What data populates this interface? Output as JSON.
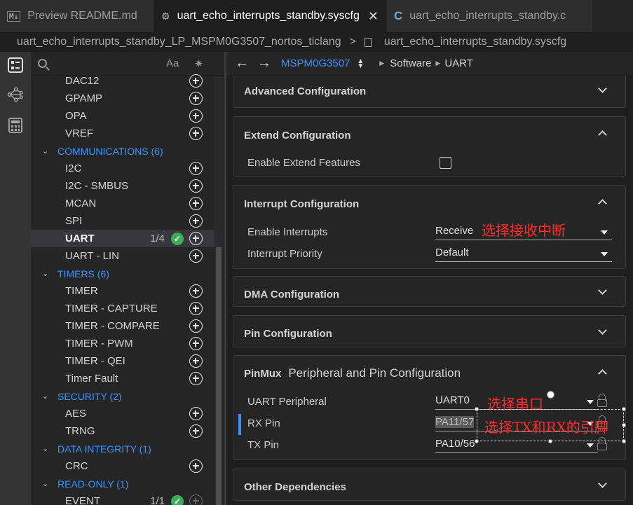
{
  "tabs": [
    {
      "icon": "markdown-icon",
      "icon_text": "M↓",
      "label": "Preview README.md",
      "active": false
    },
    {
      "icon": "gear-icon",
      "icon_text": "⚙",
      "label": "uart_echo_interrupts_standby.syscfg",
      "active": true,
      "close": "✕"
    },
    {
      "icon": "c-file-icon",
      "icon_text": "C",
      "label": "uart_echo_interrupts_standby.c",
      "active": false
    }
  ],
  "breadcrumb": {
    "folder": "uart_echo_interrupts_standby_LP_MSPM0G3507_nortos_ticlang",
    "separator": ">",
    "file": "uart_echo_interrupts_standby.syscfg"
  },
  "search": {
    "aa": "Aa",
    "regex": "✷"
  },
  "sidebar_rows": [
    {
      "type": "item",
      "label": "DAC12",
      "plus": true
    },
    {
      "type": "item",
      "label": "GPAMP",
      "plus": true
    },
    {
      "type": "item",
      "label": "OPA",
      "plus": true
    },
    {
      "type": "item",
      "label": "VREF",
      "plus": true
    },
    {
      "type": "cat",
      "label": "COMMUNICATIONS (6)"
    },
    {
      "type": "item",
      "label": "I2C",
      "plus": true
    },
    {
      "type": "item",
      "label": "I2C - SMBUS",
      "plus": true
    },
    {
      "type": "item",
      "label": "MCAN",
      "plus": true
    },
    {
      "type": "item",
      "label": "SPI",
      "plus": true
    },
    {
      "type": "item",
      "label": "UART",
      "count": "1/4",
      "check": true,
      "plus": true,
      "selected": true
    },
    {
      "type": "item",
      "label": "UART - LIN",
      "plus": true
    },
    {
      "type": "cat",
      "label": "TIMERS (6)"
    },
    {
      "type": "item",
      "label": "TIMER",
      "plus": true
    },
    {
      "type": "item",
      "label": "TIMER - CAPTURE",
      "plus": true
    },
    {
      "type": "item",
      "label": "TIMER - COMPARE",
      "plus": true
    },
    {
      "type": "item",
      "label": "TIMER - PWM",
      "plus": true
    },
    {
      "type": "item",
      "label": "TIMER - QEI",
      "plus": true
    },
    {
      "type": "item",
      "label": "Timer Fault",
      "plus": true
    },
    {
      "type": "cat",
      "label": "SECURITY (2)"
    },
    {
      "type": "item",
      "label": "AES",
      "plus": true
    },
    {
      "type": "item",
      "label": "TRNG",
      "plus": true
    },
    {
      "type": "cat",
      "label": "DATA INTEGRITY (1)"
    },
    {
      "type": "item",
      "label": "CRC",
      "plus": true
    },
    {
      "type": "cat",
      "label": "READ-ONLY (1)"
    },
    {
      "type": "item",
      "label": "EVENT",
      "count": "1/1",
      "check": true,
      "plus": true,
      "dim": true
    }
  ],
  "nav": {
    "back": "←",
    "forward": "→",
    "device": "MSPM0G3507",
    "path": [
      "Software",
      "UART"
    ]
  },
  "panels": {
    "advanced": {
      "title": "Advanced Configuration"
    },
    "extend": {
      "title": "Extend Configuration",
      "field": "Enable Extend Features",
      "checked": false
    },
    "interrupt": {
      "title": "Interrupt Configuration",
      "enable_label": "Enable Interrupts",
      "enable_value": "Receive",
      "priority_label": "Interrupt Priority",
      "priority_value": "Default"
    },
    "dma": {
      "title": "DMA Configuration"
    },
    "pin": {
      "title": "Pin Configuration"
    },
    "pinmux": {
      "title": "PinMux",
      "subtitle": "Peripheral and Pin Configuration",
      "peripheral_label": "UART Peripheral",
      "peripheral_value": "UART0",
      "rx_label": "RX Pin",
      "rx_value": "PA11/57",
      "tx_label": "TX Pin",
      "tx_value": "PA10/56"
    },
    "other": {
      "title": "Other Dependencies"
    }
  },
  "annotations": {
    "interrupt_note": "选择接收中断",
    "port_note": "选择串口",
    "pins_note": "选择TX和RX的引脚"
  },
  "colors": {
    "accent_blue": "#3794ff",
    "annotation_red": "#ff2a2a",
    "check_green": "#3cae5a"
  }
}
